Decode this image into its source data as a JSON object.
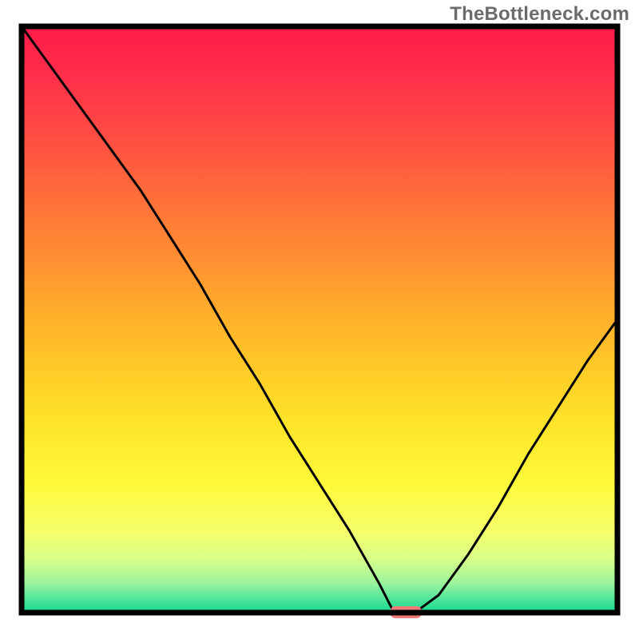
{
  "watermark": "TheBottleneck.com",
  "chart_data": {
    "type": "line",
    "x": [
      0.0,
      0.05,
      0.1,
      0.15,
      0.2,
      0.25,
      0.3,
      0.35,
      0.4,
      0.45,
      0.5,
      0.55,
      0.6,
      0.625,
      0.66,
      0.7,
      0.75,
      0.8,
      0.85,
      0.9,
      0.95,
      1.0
    ],
    "values": [
      1.0,
      0.93,
      0.86,
      0.79,
      0.72,
      0.64,
      0.56,
      0.47,
      0.39,
      0.3,
      0.22,
      0.14,
      0.05,
      0.0,
      0.0,
      0.03,
      0.1,
      0.18,
      0.27,
      0.35,
      0.43,
      0.5
    ],
    "title": "",
    "xlabel": "",
    "ylabel": "",
    "xlim": [
      0,
      1
    ],
    "ylim": [
      0,
      1
    ],
    "marker": {
      "x": 0.645,
      "y": 0.0
    },
    "background": "rainbow-vertical-gradient",
    "border": true
  }
}
